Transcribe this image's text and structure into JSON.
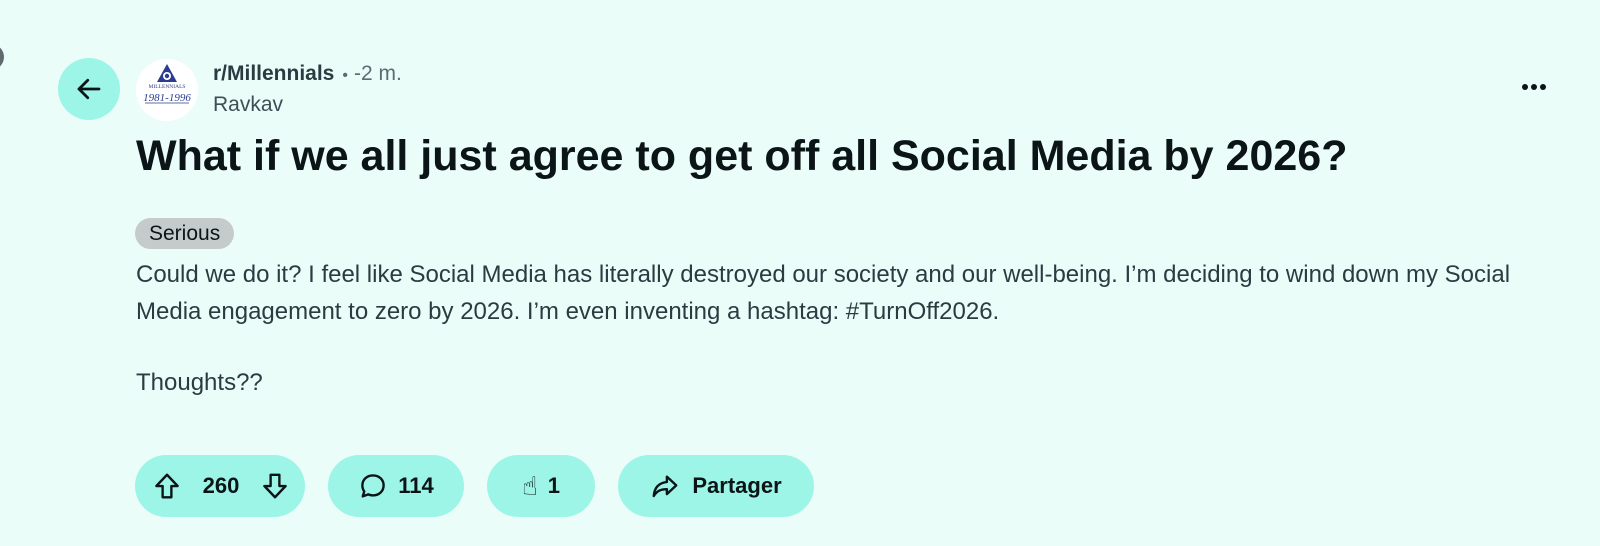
{
  "post": {
    "subreddit": "r/Millennials",
    "separator": "•",
    "time": "-2 m.",
    "author": "Ravkav",
    "title": "What if we all just agree to get off all Social Media by 2026?",
    "flair": "Serious",
    "body": "Could we do it? I feel like Social Media has literally destroyed our society and our well-being. I’m deciding to wind down my Social Media engagement to zero by 2026. I’m even inventing a hashtag: #TurnOff2026.",
    "body_closing": "Thoughts??"
  },
  "avatar": {
    "logo_text_top": "MILLENNIALS",
    "logo_text_bottom": "1981-1996"
  },
  "actions": {
    "vote_count": "260",
    "comment_count": "114",
    "award_count": "1",
    "share_label": "Partager"
  },
  "icons": {
    "back": "arrow-left-icon",
    "more": "more-horizontal-icon",
    "upvote": "arrow-up-icon",
    "downvote": "arrow-down-icon",
    "comment": "speech-bubble-icon",
    "award": "pointing-hand-icon",
    "share": "share-arrow-icon"
  },
  "colors": {
    "background": "#ebfdf9",
    "button_fill": "#9cf5e6",
    "flair_fill": "#c5cbcb",
    "text_primary": "#0b1416"
  }
}
